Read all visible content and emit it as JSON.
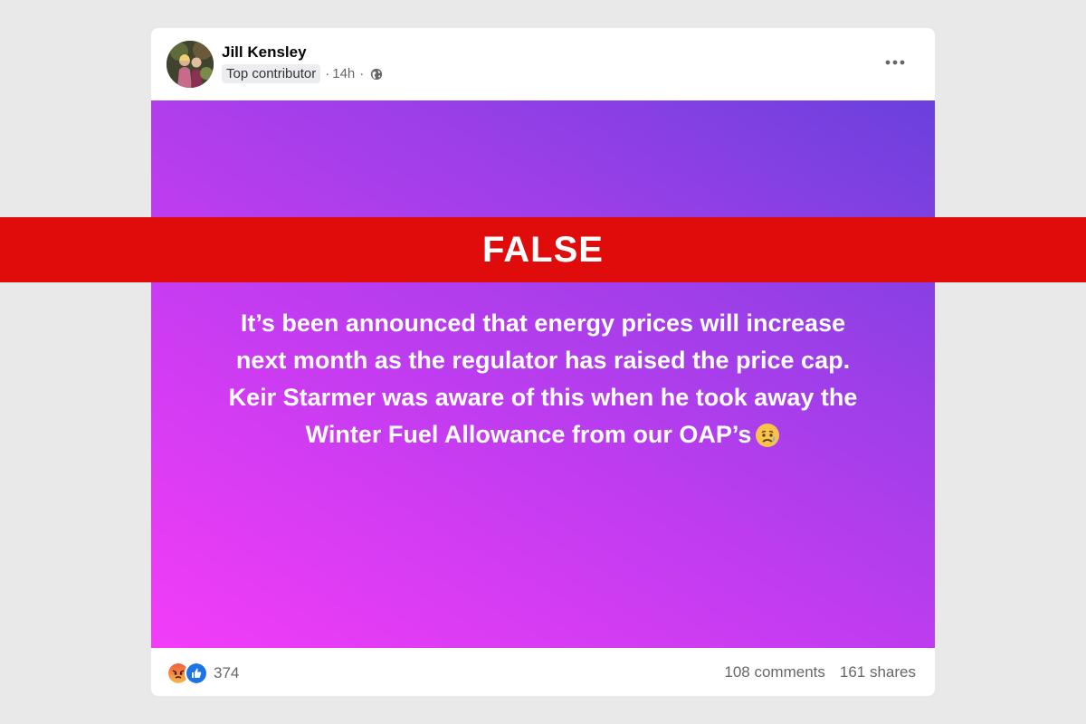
{
  "post": {
    "author": "Jill Kensley",
    "badge": "Top contributor",
    "time_sep": "·",
    "time": "14h",
    "time_sep2": "·",
    "body_lines": [
      "It’s been announced that energy prices will increase",
      "next month as the regulator has raised the price cap.",
      "Keir Starmer was aware of this when he took away the",
      "Winter Fuel Allowance from our OAP’s"
    ],
    "body_emoji": "sad-relieved-face-emoji",
    "background_colors": [
      "#f33cf8",
      "#c43cf0",
      "#9a3fe8",
      "#6a40dc"
    ]
  },
  "footer": {
    "reaction_icons": [
      "angry-reaction-icon",
      "like-reaction-icon"
    ],
    "reaction_count": "374",
    "comments": "108 comments",
    "shares": "161 shares"
  },
  "banner": {
    "label": "FALSE",
    "color": "#e00b0b"
  },
  "icons": {
    "more": "more-options-icon",
    "privacy": "globe-icon"
  }
}
